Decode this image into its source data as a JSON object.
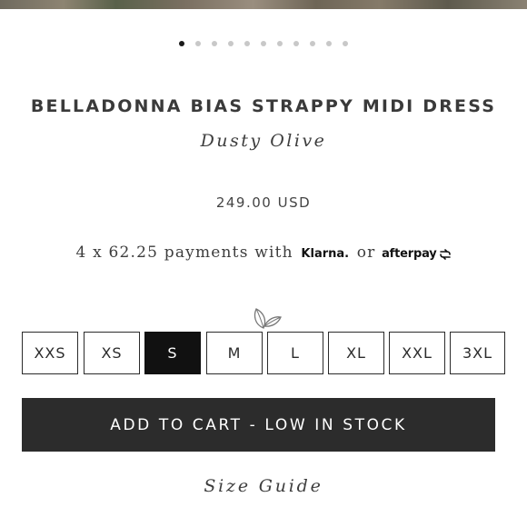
{
  "carousel": {
    "count": 11,
    "active_index": 0
  },
  "product": {
    "title": "BELLADONNA BIAS STRAPPY MIDI DRESS",
    "color": "Dusty Olive",
    "price": "249.00 USD"
  },
  "payments": {
    "prefix": "4 x 62.25 payments with ",
    "klarna": "Klarna.",
    "or": " or ",
    "afterpay": "afterpay"
  },
  "sizes": {
    "options": [
      "XXS",
      "XS",
      "S",
      "M",
      "L",
      "XL",
      "XXL",
      "3XL"
    ],
    "selected": "S",
    "eco_icon": "leaf-icon"
  },
  "cart": {
    "label": "ADD TO CART - LOW IN STOCK"
  },
  "size_guide": {
    "label": "Size Guide"
  },
  "colors": {
    "selected_bg": "#111111",
    "button_bg": "#2c2c2c",
    "text": "#333333"
  }
}
